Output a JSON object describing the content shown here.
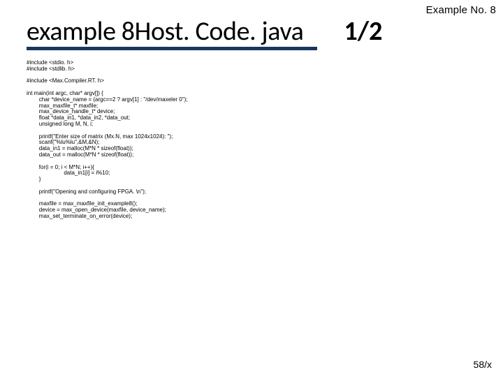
{
  "header": {
    "example_tag": "Example No. 8"
  },
  "title": {
    "text": "example 8Host. Code. java",
    "pager": "1/2"
  },
  "code": "#include <stdio. h>\n#include <stdlib. h>\n\n#include <Max.Compiler.RT. h>\n\nint main(int argc, char* argv[]) {\n        char *device_name = (argc==2 ? argv[1] : \"/dev/maxeler 0\");\n        max_maxfile_t* maxfile;\n        max_device_handle_t* device;\n        float *data_in1, *data_in2, *data_out;\n        unsigned long M, N, i;\n\n        printf(\"Enter size of matrix (Mx.N, max 1024x1024): \");\n        scanf(\"%lu%lu\",&M,&N);\n        data_in1 = malloc(M*N * sizeof(float));\n        data_out = malloc(M*N * sizeof(float));\n\n        for(i = 0; i < M*N; i++){\n                        data_in1[i] = i%10;\n        }\n\n        printf(\"Opening and configuring FPGA. \\n\");\n\n        maxfile = max_maxfile_init_example8();\n        device = max_open_device(maxfile, device_name);\n        max_set_terminate_on_error(device);",
  "footer": {
    "page": "58/x"
  }
}
